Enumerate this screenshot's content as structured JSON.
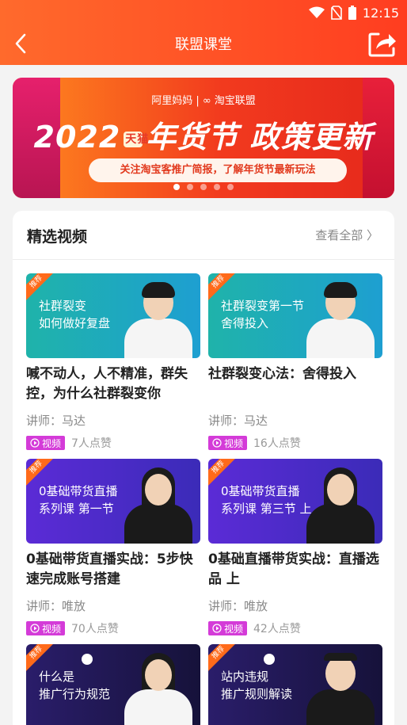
{
  "status_bar": {
    "time": "12:15"
  },
  "nav": {
    "title": "联盟课堂"
  },
  "banner": {
    "brand": "阿里妈妈 | ∞ 淘宝联盟",
    "year": "2022",
    "tmall": "天猫",
    "headline_rest": "年货节 政策更新",
    "subline": "关注淘宝客推广简报，了解年货节最新玩法",
    "dot_count": 5,
    "active_dot": 0
  },
  "section": {
    "title": "精选视频",
    "see_all": "查看全部 〉"
  },
  "items": [
    {
      "tag": "推荐",
      "thumb_line1": "社群裂变",
      "thumb_line2": "如何做好复盘",
      "title": "喊不动人，人不精准，群失控，为什么社群裂变你",
      "lecturer": "讲师：马达",
      "type": "视频",
      "likes": "7人点赞"
    },
    {
      "tag": "推荐",
      "thumb_line1": "社群裂变第一节",
      "thumb_line2": "舍得投入",
      "title": "社群裂变心法：舍得投入",
      "lecturer": "讲师：马达",
      "type": "视频",
      "likes": "16人点赞"
    },
    {
      "tag": "推荐",
      "thumb_line1": "0基础带货直播",
      "thumb_line2": "系列课 第一节",
      "title": "0基础带货直播实战：5步快速完成账号搭建",
      "lecturer": "讲师：唯放",
      "type": "视频",
      "likes": "70人点赞"
    },
    {
      "tag": "推荐",
      "thumb_line1": "0基础带货直播",
      "thumb_line2": "系列课 第三节 上",
      "title": "0基础直播带货实战：直播选品 上",
      "lecturer": "讲师：唯放",
      "type": "视频",
      "likes": "42人点赞"
    },
    {
      "tag": "推荐",
      "thumb_line1": "什么是",
      "thumb_line2": "推广行为规范",
      "title": "",
      "lecturer": "",
      "type": "",
      "likes": ""
    },
    {
      "tag": "推荐",
      "thumb_line1": "站内违规",
      "thumb_line2": "推广规则解读",
      "title": "",
      "lecturer": "",
      "type": "",
      "likes": ""
    }
  ]
}
